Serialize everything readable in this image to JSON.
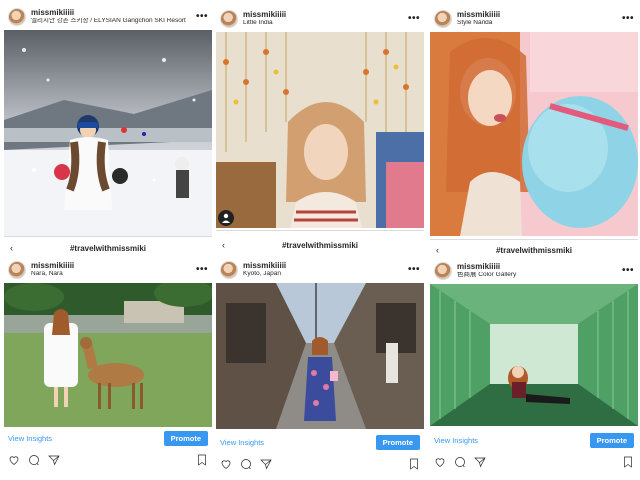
{
  "user": "missmikiiiii",
  "hashtag": "#travelwithmissmiki",
  "back_glyph": "‹",
  "menu_glyph": "•••",
  "view_insights": "View Insights",
  "promote": "Promote",
  "columns": [
    {
      "top": {
        "location": "엘리시안 강촌 스키장 / ELYSIAN Gangchon SKI Resort"
      },
      "bottom": {
        "location": "Nara, Nara"
      }
    },
    {
      "top": {
        "location": "Little India"
      },
      "bottom": {
        "location": "Kyoto, Japan"
      }
    },
    {
      "top": {
        "location": "Style Nanda"
      },
      "bottom": {
        "location": "色商展 Color Gallery"
      }
    }
  ],
  "icons": {
    "like": "heart-icon",
    "comment": "comment-icon",
    "share": "paper-plane-icon",
    "save": "bookmark-icon",
    "tagged": "person-icon",
    "menu": "more-dots-icon",
    "back": "chevron-left-icon"
  },
  "colors": {
    "accent": "#3897f0",
    "text": "#262626",
    "divider": "#dbdbdb"
  }
}
